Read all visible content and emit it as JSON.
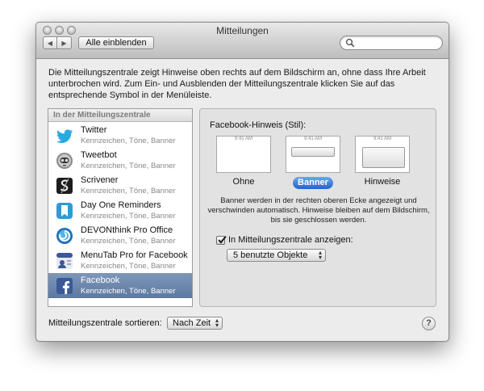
{
  "window": {
    "title": "Mitteilungen",
    "show_all_label": "Alle einblenden",
    "nav_back": "◀",
    "nav_forward": "▶",
    "search_placeholder": ""
  },
  "description": "Die Mitteilungszentrale zeigt Hinweise oben rechts auf dem Bildschirm an, ohne dass Ihre Arbeit unterbrochen wird. Zum Ein- und Ausblenden der Mitteilungszentrale klicken Sie auf das entsprechende Symbol in der Menüleiste.",
  "sidebar": {
    "section_header": "In der Mitteilungszentrale",
    "items": [
      {
        "name": "Twitter",
        "subtitle": "Kennzeichen, Töne, Banner",
        "icon": "twitter-bird-icon",
        "selected": false
      },
      {
        "name": "Tweetbot",
        "subtitle": "Kennzeichen, Töne, Banner",
        "icon": "tweetbot-robot-icon",
        "selected": false
      },
      {
        "name": "Scrivener",
        "subtitle": "Kennzeichen, Töne, Banner",
        "icon": "scrivener-icon",
        "selected": false
      },
      {
        "name": "Day One Reminders",
        "subtitle": "Kennzeichen, Töne, Banner",
        "icon": "bookmark-icon",
        "selected": false
      },
      {
        "name": "DEVONthink Pro Office",
        "subtitle": "Kennzeichen, Töne, Banner",
        "icon": "devonthink-icon",
        "selected": false
      },
      {
        "name": "MenuTab Pro for Facebook",
        "subtitle": "Kennzeichen, Töne, Banner",
        "icon": "menutab-icon",
        "selected": false
      },
      {
        "name": "Facebook",
        "subtitle": "Kennzeichen, Töne, Banner",
        "icon": "facebook-icon",
        "selected": true
      }
    ]
  },
  "panel": {
    "heading": "Facebook-Hinweis (Stil):",
    "preview_time": "9:41 AM",
    "styles": [
      {
        "label": "Ohne",
        "selected": false
      },
      {
        "label": "Banner",
        "selected": true
      },
      {
        "label": "Hinweise",
        "selected": false
      }
    ],
    "info": "Banner werden in der rechten oberen Ecke angezeigt und verschwinden automatisch. Hinweise bleiben auf dem Bildschirm, bis sie geschlossen werden.",
    "show_in_center_label": "In Mitteilungszentrale anzeigen:",
    "show_in_center_checked": true,
    "item_count_value": "5 benutzte Objekte"
  },
  "footer": {
    "sort_label": "Mitteilungszentrale sortieren:",
    "sort_value": "Nach Zeit",
    "help_label": "?"
  },
  "colors": {
    "selection": "#6a85ac",
    "selected_pill": "#2f74db",
    "twitter_blue": "#2aa9e0",
    "facebook_blue": "#3b5998"
  }
}
